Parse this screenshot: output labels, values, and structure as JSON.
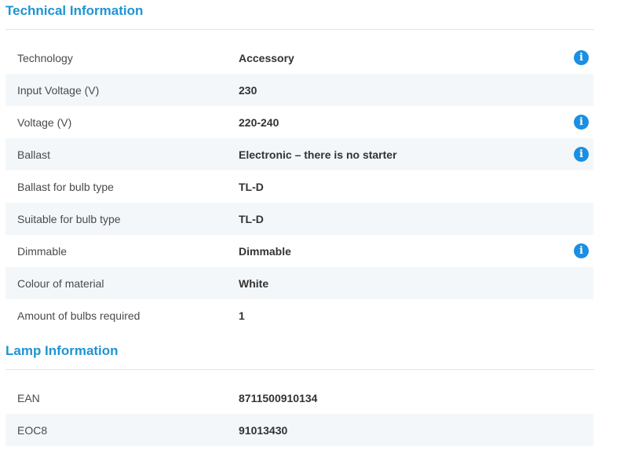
{
  "technical": {
    "title": "Technical Information",
    "rows": [
      {
        "label": "Technology",
        "value": "Accessory",
        "info": true
      },
      {
        "label": "Input Voltage (V)",
        "value": "230",
        "info": false
      },
      {
        "label": "Voltage (V)",
        "value": "220-240",
        "info": true
      },
      {
        "label": "Ballast",
        "value": "Electronic – there is no starter",
        "info": true
      },
      {
        "label": "Ballast for bulb type",
        "value": "TL-D",
        "info": false
      },
      {
        "label": "Suitable for bulb type",
        "value": "TL-D",
        "info": false
      },
      {
        "label": "Dimmable",
        "value": "Dimmable",
        "info": true
      },
      {
        "label": "Colour of material",
        "value": "White",
        "info": false
      },
      {
        "label": "Amount of bulbs required",
        "value": "1",
        "info": false
      }
    ]
  },
  "lamp": {
    "title": "Lamp Information",
    "rows": [
      {
        "label": "EAN",
        "value": "8711500910134",
        "info": false
      },
      {
        "label": "EOC8",
        "value": "91013430",
        "info": false
      }
    ]
  },
  "icons": {
    "info_glyph": "i",
    "info_icon_name": "info-icon",
    "info_color": "#1a8fe3"
  },
  "colors": {
    "section_title": "#1f94d2",
    "row_alt_bg": "#f3f7fa"
  }
}
